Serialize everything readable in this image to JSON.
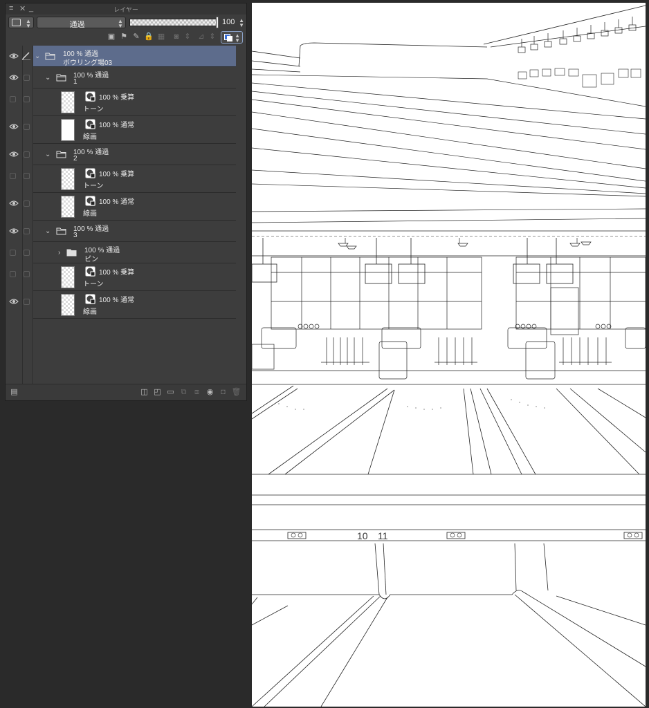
{
  "panel": {
    "title": "レイヤー",
    "blend_mode": "通過",
    "opacity_value": "100",
    "opacity_fraction": 1.0
  },
  "layers": [
    {
      "kind": "folder",
      "line1": "100 % 通過",
      "line2": "ボウリング場03",
      "selected": true
    },
    {
      "kind": "folder",
      "line1": "100 % 通過",
      "line2": "1"
    },
    {
      "kind": "layer",
      "line1": "100 % 乗算",
      "line2": "トーン"
    },
    {
      "kind": "layer",
      "line1": "100 % 通常",
      "line2": "線画"
    },
    {
      "kind": "folder",
      "line1": "100 % 通過",
      "line2": "2"
    },
    {
      "kind": "layer",
      "line1": "100 % 乗算",
      "line2": "トーン"
    },
    {
      "kind": "layer",
      "line1": "100 % 通常",
      "line2": "線画"
    },
    {
      "kind": "folder",
      "line1": "100 % 通過",
      "line2": "3"
    },
    {
      "kind": "folder",
      "line1": "100 % 通過",
      "line2": "ピン"
    },
    {
      "kind": "layer",
      "line1": "100 % 乗算",
      "line2": "トーン"
    },
    {
      "kind": "layer",
      "line1": "100 % 通常",
      "line2": "線画"
    }
  ],
  "canvas": {
    "lane_numbers": [
      "10",
      "11"
    ]
  },
  "colors": {
    "selection": "#5d6c8c",
    "panel_bg": "#3d3d3d",
    "app_bg": "#2a2a2a",
    "layer_color_blue": "#3a6fd8"
  },
  "icons": {
    "visibility": "eye-icon",
    "lock": "lock-icon",
    "folder": "folder-icon",
    "edit": "pencil-icon"
  }
}
